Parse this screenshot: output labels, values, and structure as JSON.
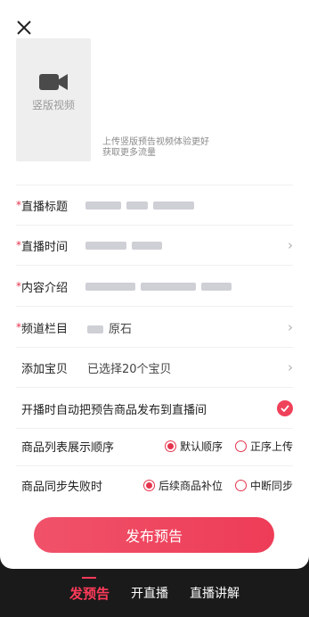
{
  "uploader": {
    "label": "竖版视频",
    "tip_line1": "上传竖版预告视频体验更好",
    "tip_line2": "获取更多流量"
  },
  "form": {
    "required_mark": "*",
    "title_label": "直播标题",
    "time_label": "直播时间",
    "intro_label": "内容介绍",
    "channel_label": "频道栏目",
    "channel_value_visible": "原石",
    "add_goods_label": "添加宝贝",
    "add_goods_value": "已选择20个宝贝",
    "auto_publish_label": "开播时自动把预告商品发布到直播间",
    "order_label": "商品列表展示顺序",
    "order_options": [
      "默认顺序",
      "正序上传"
    ],
    "sync_label": "商品同步失败时",
    "sync_options": [
      "后续商品补位",
      "中断同步"
    ]
  },
  "publish_button": "发布预告",
  "bottom_tabs": [
    "发预告",
    "开直播",
    "直播讲解"
  ],
  "colors": {
    "accent": "#ee3c57",
    "bg_dark": "#1a1a1a"
  },
  "icons": {
    "close": "close-icon",
    "camera": "video-camera-icon",
    "chevron": "chevron-right-icon",
    "check": "check-circle-icon"
  }
}
